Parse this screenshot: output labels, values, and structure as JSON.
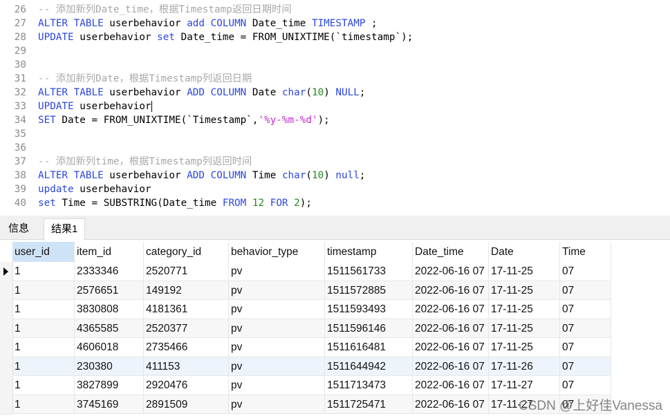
{
  "editor": {
    "lines": [
      {
        "n": "26",
        "parts": [
          {
            "t": "-- 添加新列Date_time，根据Timestamp返回日期时间",
            "c": "cm"
          }
        ]
      },
      {
        "n": "27",
        "parts": [
          {
            "t": "ALTER TABLE",
            "c": "kw"
          },
          {
            "t": " userbehavior ",
            "c": ""
          },
          {
            "t": "add COLUMN",
            "c": "kw"
          },
          {
            "t": " Date_time ",
            "c": ""
          },
          {
            "t": "TIMESTAMP",
            "c": "kw"
          },
          {
            "t": " ;",
            "c": ""
          }
        ]
      },
      {
        "n": "28",
        "parts": [
          {
            "t": "UPDATE",
            "c": "kw"
          },
          {
            "t": " userbehavior ",
            "c": ""
          },
          {
            "t": "set",
            "c": "kw"
          },
          {
            "t": " Date_time = FROM_UNIXTIME(`timestamp`);",
            "c": ""
          }
        ]
      },
      {
        "n": "29",
        "parts": []
      },
      {
        "n": "30",
        "parts": []
      },
      {
        "n": "31",
        "parts": [
          {
            "t": "-- 添加新列Date，根据Timestamp列返回日期",
            "c": "cm"
          }
        ]
      },
      {
        "n": "32",
        "parts": [
          {
            "t": "ALTER TABLE",
            "c": "kw"
          },
          {
            "t": " userbehavior ",
            "c": ""
          },
          {
            "t": "ADD COLUMN",
            "c": "kw"
          },
          {
            "t": " Date ",
            "c": ""
          },
          {
            "t": "char",
            "c": "kw"
          },
          {
            "t": "(",
            "c": ""
          },
          {
            "t": "10",
            "c": "nm"
          },
          {
            "t": ") ",
            "c": ""
          },
          {
            "t": "NULL",
            "c": "kw"
          },
          {
            "t": ";",
            "c": ""
          }
        ]
      },
      {
        "n": "33",
        "parts": [
          {
            "t": "UPDATE",
            "c": "kw"
          },
          {
            "t": " userbehavior",
            "c": ""
          }
        ],
        "caret": true
      },
      {
        "n": "34",
        "parts": [
          {
            "t": "SET",
            "c": "kw"
          },
          {
            "t": " Date = FROM_UNIXTIME(`Timestamp`,",
            "c": ""
          },
          {
            "t": "'%y-%m-%d'",
            "c": "st"
          },
          {
            "t": ");",
            "c": ""
          }
        ]
      },
      {
        "n": "35",
        "parts": []
      },
      {
        "n": "36",
        "parts": []
      },
      {
        "n": "37",
        "parts": [
          {
            "t": "-- 添加新列time，根据Timestamp列返回时间",
            "c": "cm"
          }
        ]
      },
      {
        "n": "38",
        "parts": [
          {
            "t": "ALTER TABLE",
            "c": "kw"
          },
          {
            "t": " userbehavior ",
            "c": ""
          },
          {
            "t": "ADD COLUMN",
            "c": "kw"
          },
          {
            "t": " Time ",
            "c": ""
          },
          {
            "t": "char",
            "c": "kw"
          },
          {
            "t": "(",
            "c": ""
          },
          {
            "t": "10",
            "c": "nm"
          },
          {
            "t": ") ",
            "c": ""
          },
          {
            "t": "null",
            "c": "kw"
          },
          {
            "t": ";",
            "c": ""
          }
        ]
      },
      {
        "n": "39",
        "parts": [
          {
            "t": "update",
            "c": "kw"
          },
          {
            "t": " userbehavior",
            "c": ""
          }
        ]
      },
      {
        "n": "40",
        "parts": [
          {
            "t": "set",
            "c": "kw"
          },
          {
            "t": " Time = SUBSTRING(Date_time ",
            "c": ""
          },
          {
            "t": "FROM",
            "c": "kw"
          },
          {
            "t": " ",
            "c": ""
          },
          {
            "t": "12",
            "c": "nm"
          },
          {
            "t": " ",
            "c": ""
          },
          {
            "t": "FOR",
            "c": "kw"
          },
          {
            "t": " ",
            "c": ""
          },
          {
            "t": "2",
            "c": "nm"
          },
          {
            "t": ");",
            "c": ""
          }
        ]
      }
    ]
  },
  "tabs": {
    "info": "信息",
    "result": "结果1"
  },
  "table": {
    "columns": [
      "user_id",
      "item_id",
      "category_id",
      "behavior_type",
      "timestamp",
      "Date_time",
      "Date",
      "Time"
    ],
    "rows": [
      [
        "1",
        "2333346",
        "2520771",
        "pv",
        "1511561733",
        "2022-06-16 07",
        "17-11-25",
        "07"
      ],
      [
        "1",
        "2576651",
        "149192",
        "pv",
        "1511572885",
        "2022-06-16 07",
        "17-11-25",
        "07"
      ],
      [
        "1",
        "3830808",
        "4181361",
        "pv",
        "1511593493",
        "2022-06-16 07",
        "17-11-25",
        "07"
      ],
      [
        "1",
        "4365585",
        "2520377",
        "pv",
        "1511596146",
        "2022-06-16 07",
        "17-11-25",
        "07"
      ],
      [
        "1",
        "4606018",
        "2735466",
        "pv",
        "1511616481",
        "2022-06-16 07",
        "17-11-25",
        "07"
      ],
      [
        "1",
        "230380",
        "411153",
        "pv",
        "1511644942",
        "2022-06-16 07",
        "17-11-26",
        "07"
      ],
      [
        "1",
        "3827899",
        "2920476",
        "pv",
        "1511713473",
        "2022-06-16 07",
        "17-11-27",
        "07"
      ],
      [
        "1",
        "3745169",
        "2891509",
        "pv",
        "1511725471",
        "2022-06-16 07",
        "17-11-27",
        "07"
      ]
    ]
  },
  "watermark": "CSDN @上好佳Vanessa"
}
